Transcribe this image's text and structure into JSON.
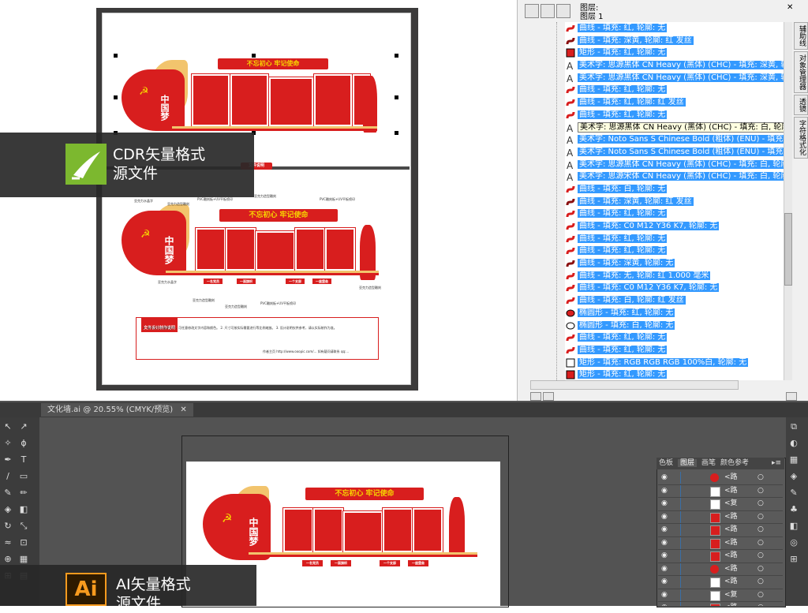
{
  "cdr": {
    "preview": {
      "banner_top": "不忘初心  牢记使命",
      "banner_bottom": "不忘初心  牢记使命",
      "center_tag": "文件说明",
      "left_slogan": "中国梦",
      "bottom_chips": [
        "一名党员",
        "一面旗帜",
        "一个支部",
        "一座堡垒"
      ],
      "callouts": [
        "亚克力水晶字",
        "亚克力造型雕刻",
        "PVC雕刻板+UV平板喷印",
        "亚克力造型雕刻",
        "PVC雕刻板+UV平板喷印",
        "亚克力水晶字",
        "亚克力造型雕刻",
        "亚克力造型雕刻",
        "PVC雕刻板+UV平板喷印",
        "亚克力造型雕刻"
      ],
      "notes_title": "文件设计制作说明",
      "notes_text": "1. 本作品为矢量源文件，可任意修改文字内容和颜色。 2. 尺寸可按实际需要进行等比例缩放。 3. 设计说明仅供参考，请以实际制作为准。",
      "notes_link": "作者主页 http://www.ooopic.com/... 如有疑问请联系 qq:..."
    },
    "badge": {
      "line1": "CDR矢量格式",
      "line2": "源文件"
    }
  },
  "object_manager": {
    "title_line1": "图层:",
    "title_line2": "图层 1",
    "tooltip": "美术字: 思源黑体 CN Heavy (黑体) (CHC) - 填充: 白, 轮廓: 无",
    "rows": [
      {
        "icon": "curve-icon",
        "color": "#d81e1e",
        "label": "曲线 - 填充: 红, 轮廓: 无"
      },
      {
        "icon": "curve-icon",
        "color": "#8a1010",
        "label": "曲线 - 填充: 深黄, 轮廓: 红 发丝"
      },
      {
        "icon": "rect-icon",
        "color": "#d81e1e",
        "label": "矩形 - 填充: 红, 轮廓: 无"
      },
      {
        "icon": "text-icon",
        "color": "#333333",
        "label": "美术字: 思源黑体 CN Heavy (黑体) (CHC) - 填充: 深黄, 轮廓: 无"
      },
      {
        "icon": "text-icon",
        "color": "#333333",
        "label": "美术字: 思源黑体 CN Heavy (黑体) (CHC) - 填充: 深黄, 轮廓: 无"
      },
      {
        "icon": "curve-icon",
        "color": "#d81e1e",
        "label": "曲线 - 填充: 红, 轮廓: 无"
      },
      {
        "icon": "curve-icon",
        "color": "#d81e1e",
        "label": "曲线 - 填充: 红, 轮廓: 红 发丝"
      },
      {
        "icon": "curve-icon",
        "color": "#d81e1e",
        "label": "曲线 - 填充: 红, 轮廓: 无"
      },
      {
        "icon": "text-icon",
        "color": "#333333",
        "label": "美术字: 思源黑体 CN Heavy (黑体) (CHC) - 填充: 白, 轮廓: 无",
        "tip": true
      },
      {
        "icon": "text-icon",
        "color": "#333333",
        "label": "美术字: Noto Sans S Chinese Bold (粗体) (ENU) - 填充: 白"
      },
      {
        "icon": "text-icon",
        "color": "#333333",
        "label": "美术字: Noto Sans S Chinese Bold (粗体) (ENU) - 填充: 白"
      },
      {
        "icon": "text-icon",
        "color": "#333333",
        "label": "美术字: 思源黑体 CN Heavy (黑体) (CHC) - 填充: 白, 轮廓"
      },
      {
        "icon": "text-icon",
        "color": "#333333",
        "label": "美术字: 思源宋体 CN Heavy (黑体) (CHC) - 填充: 白, 轮廓"
      },
      {
        "icon": "curve-icon",
        "color": "#d81e1e",
        "label": "曲线 - 填充: 白, 轮廓: 无"
      },
      {
        "icon": "curve-icon",
        "color": "#8a1010",
        "label": "曲线 - 填充: 深黄, 轮廓: 红 发丝"
      },
      {
        "icon": "curve-icon",
        "color": "#d81e1e",
        "label": "曲线 - 填充: 红, 轮廓: 无"
      },
      {
        "icon": "curve-icon",
        "color": "#d81e1e",
        "label": "曲线 - 填充: C0 M12 Y36 K7, 轮廓: 无"
      },
      {
        "icon": "curve-icon",
        "color": "#d81e1e",
        "label": "曲线 - 填充: 红, 轮廓: 无"
      },
      {
        "icon": "curve-icon",
        "color": "#d81e1e",
        "label": "曲线 - 填充: 红, 轮廓: 无"
      },
      {
        "icon": "curve-icon",
        "color": "#8a1010",
        "label": "曲线 - 填充: 深黄, 轮廓: 无"
      },
      {
        "icon": "curve-icon",
        "color": "#d81e1e",
        "label": "曲线 - 填充: 无, 轮廓: 红  1.000 毫米"
      },
      {
        "icon": "curve-icon",
        "color": "#d81e1e",
        "label": "曲线 - 填充: C0 M12 Y36 K7, 轮廓: 无"
      },
      {
        "icon": "curve-icon",
        "color": "#d81e1e",
        "label": "曲线 - 填充: 白, 轮廓: 红 发丝"
      },
      {
        "icon": "ellipse-icon",
        "color": "#d81e1e",
        "label": "椭圆形 - 填充: 红, 轮廓: 无"
      },
      {
        "icon": "ellipse-outline-icon",
        "color": "#ffffff",
        "label": "椭圆形 - 填充: 白, 轮廓: 无"
      },
      {
        "icon": "curve-icon",
        "color": "#d81e1e",
        "label": "曲线 - 填充: 红, 轮廓: 无"
      },
      {
        "icon": "curve-icon",
        "color": "#d81e1e",
        "label": "曲线 - 填充: 红, 轮廓: 无"
      },
      {
        "icon": "rect-outline-icon",
        "color": "#ffffff",
        "label": "矩形 - 填充: RGB RGB RGB 100%白, 轮廓: 无"
      },
      {
        "icon": "rect-icon",
        "color": "#d81e1e",
        "label": "矩形 - 填充: 红, 轮廓: 无"
      }
    ],
    "side_tabs": [
      "辅助线",
      "对象管理器",
      "透镜",
      "字符格式化"
    ]
  },
  "ai": {
    "tab_title": "文化墙.ai @ 20.55% (CMYK/预览)",
    "layers_tabs": [
      "色板",
      "图层",
      "画笔",
      "颜色参考"
    ],
    "layer_rows": [
      {
        "swatch": "#d81e1e",
        "shape": "circle",
        "name": "<路"
      },
      {
        "swatch": "#ffffff",
        "shape": "square",
        "name": "<路"
      },
      {
        "swatch": "#ffffff",
        "shape": "square",
        "name": "<复"
      },
      {
        "swatch": "#d81e1e",
        "shape": "square",
        "name": "<路"
      },
      {
        "swatch": "#d81e1e",
        "shape": "square",
        "name": "<路"
      },
      {
        "swatch": "#d81e1e",
        "shape": "square",
        "name": "<路"
      },
      {
        "swatch": "#d81e1e",
        "shape": "square",
        "name": "<路"
      },
      {
        "swatch": "#d81e1e",
        "shape": "circle",
        "name": "<路"
      },
      {
        "swatch": "#ffffff",
        "shape": "square",
        "name": "<路"
      },
      {
        "swatch": "#ffffff",
        "shape": "square",
        "name": "<复"
      },
      {
        "swatch": "#d81e1e",
        "shape": "square",
        "name": "<路"
      },
      {
        "swatch": "#ffffff",
        "shape": "square",
        "name": "<路"
      }
    ],
    "badge": {
      "line1": "AI矢量格式",
      "line2": "源文件"
    },
    "preview": {
      "banner": "不忘初心  牢记使命",
      "left_slogan": "中国梦",
      "bottom_chips": [
        "一名党员",
        "一面旗帜",
        "一个支部",
        "一座堡垒"
      ]
    }
  },
  "colors": {
    "party_red": "#d81e1e",
    "gold": "#f2c46d",
    "selection_blue": "#3399ff",
    "cdr_green": "#7cb82f",
    "ai_orange": "#f79a1e"
  }
}
